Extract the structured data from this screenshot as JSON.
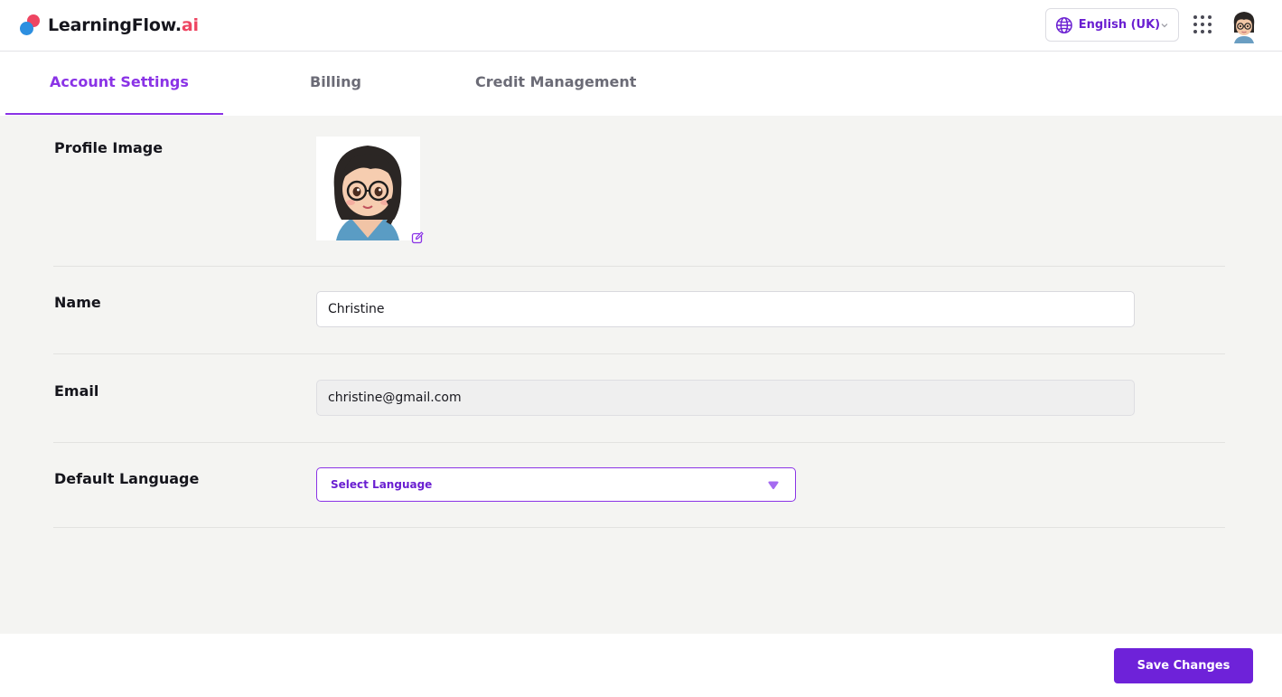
{
  "brand": {
    "name": "LearningFlow.",
    "suffix": "ai",
    "color_primary": "#6e22d9",
    "color_accent": "#ee4562"
  },
  "header": {
    "language_selector": {
      "value": "English (UK)",
      "icon": "globe-icon"
    },
    "apps_icon": "grid-icon",
    "user_avatar": "avatar"
  },
  "tabs": [
    {
      "label": "Account Settings",
      "active": true
    },
    {
      "label": "Billing",
      "active": false
    },
    {
      "label": "Credit Management",
      "active": false
    }
  ],
  "form": {
    "profile_image_label": "Profile Image",
    "name_label": "Name",
    "name_value": "Christine",
    "email_label": "Email",
    "email_value": "christine@gmail.com",
    "default_language_label": "Default Language",
    "default_language_placeholder": "Select Language"
  },
  "actions": {
    "save_label": "Save Changes"
  }
}
